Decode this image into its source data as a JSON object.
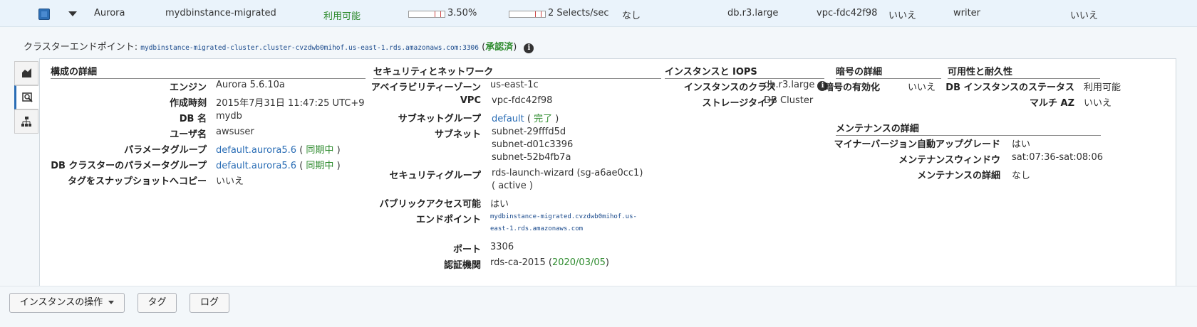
{
  "row": {
    "engine": "Aurora",
    "identifier": "mydbinstance-migrated",
    "status": "利用可能",
    "cpu": "3.50%",
    "connections": "2 Selects/sec",
    "replication": "なし",
    "class": "db.r3.large",
    "vpc": "vpc-fdc42f98",
    "multi_az": "いいえ",
    "role": "writer",
    "last_col": "いいえ"
  },
  "endpoint": {
    "label": "クラスターエンドポイント:",
    "value": "mydbinstance-migrated-cluster.cluster-cvzdwb0mihof.us-east-1.rds.amazonaws.com:3306",
    "status_open": "(",
    "status": "承認済",
    "status_close": ")"
  },
  "config": {
    "title": "構成の詳細",
    "rows": [
      {
        "label": "エンジン",
        "value": "Aurora 5.6.10a"
      },
      {
        "label": "作成時刻",
        "value": "2015年7月31日 11:47:25 UTC+9"
      },
      {
        "label": "DB 名",
        "value": "mydb"
      },
      {
        "label": "ユーザ名",
        "value": "awsuser"
      },
      {
        "label": "パラメータグループ",
        "value": "default.aurora5.6",
        "status": "同期中"
      },
      {
        "label": "DB クラスターのパラメータグループ",
        "value": "default.aurora5.6",
        "status": "同期中"
      },
      {
        "label": "タグをスナップショットへコピー",
        "value": "いいえ"
      }
    ]
  },
  "security": {
    "title": "セキュリティとネットワーク",
    "az_label": "アベイラビリティーゾーン",
    "az_value": "us-east-1c",
    "vpc_label": "VPC",
    "vpc_value": "vpc-fdc42f98",
    "subnet_group_label": "サブネットグループ",
    "subnet_group_value": "default",
    "subnet_group_status": "完了",
    "subnets_label": "サブネット",
    "subnets": [
      "subnet-29fffd5d",
      "subnet-d01c3396",
      "subnet-52b4fb7a"
    ],
    "sg_label": "セキュリティグループ",
    "sg_value": "rds-launch-wizard (sg-a6ae0cc1)",
    "sg_status": "( active )",
    "public_label": "パブリックアクセス可能",
    "public_value": "はい",
    "endpoint_label": "エンドポイント",
    "endpoint_line1": "mydbinstance-migrated.cvzdwb0mihof.us-",
    "endpoint_line2": "east-1.rds.amazonaws.com",
    "port_label": "ポート",
    "port_value": "3306",
    "ca_label": "認証機関",
    "ca_value": "rds-ca-2015",
    "ca_date": "2020/03/05"
  },
  "instance": {
    "title": "インスタンスと IOPS",
    "class_label": "インスタンスのクラス",
    "class_value": "db.r3.large",
    "storage_label": "ストレージタイプ",
    "storage_value": "DB Cluster"
  },
  "encryption": {
    "title": "暗号の詳細",
    "enabled_label": "暗号の有効化",
    "enabled_value": "いいえ"
  },
  "availability": {
    "title": "可用性と耐久性",
    "status_label": "DB インスタンスのステータス",
    "status_value": "利用可能",
    "multi_az_label": "マルチ AZ",
    "multi_az_value": "いいえ"
  },
  "maintenance": {
    "title": "メンテナンスの詳細",
    "auto_upgrade_label": "マイナーバージョン自動アップグレード",
    "auto_upgrade_value": "はい",
    "window_label": "メンテナンスウィンドウ",
    "window_value": "sat:07:36-sat:08:06",
    "details_label": "メンテナンスの詳細",
    "details_value": "なし"
  },
  "buttons": {
    "instance_actions": "インスタンスの操作",
    "tags": "タグ",
    "logs": "ログ"
  },
  "meters": {
    "cpu_fraction": 0.035,
    "connections_fraction": 0.02
  }
}
